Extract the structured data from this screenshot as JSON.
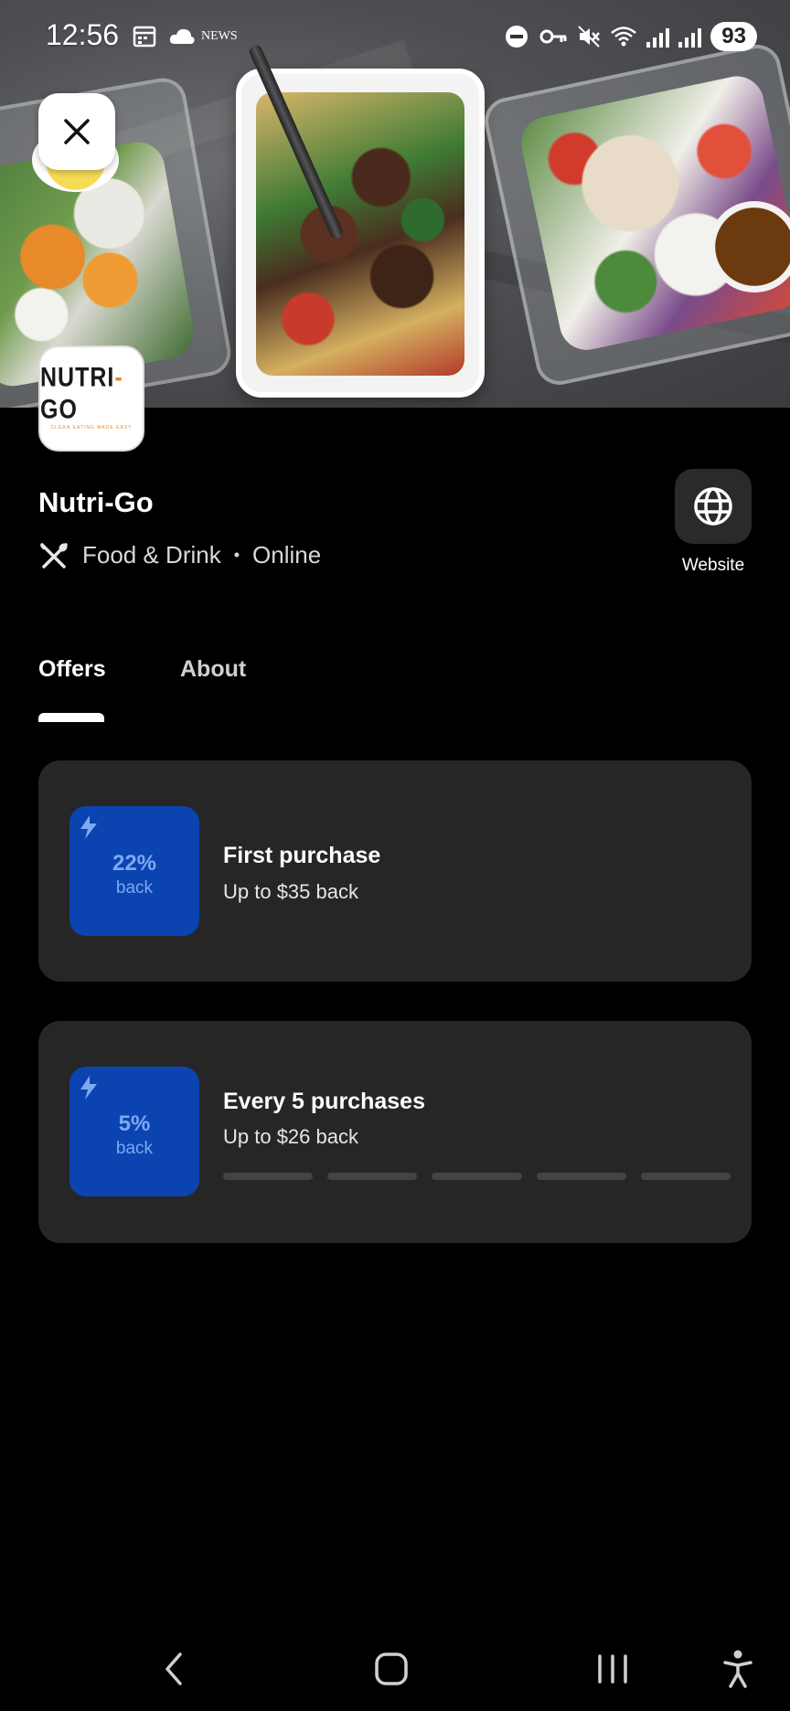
{
  "status_bar": {
    "time": "12:56",
    "news_label": "NEWS",
    "battery": "93"
  },
  "merchant": {
    "name": "Nutri-Go",
    "category": "Food & Drink",
    "separator": "•",
    "channel": "Online",
    "logo_text_left": "NUTRI",
    "logo_text_dot": "-",
    "logo_text_right": "GO",
    "logo_tagline": "CLEAN EATING MADE EASY"
  },
  "actions": {
    "website_label": "Website"
  },
  "tabs": [
    {
      "label": "Offers",
      "active": true
    },
    {
      "label": "About",
      "active": false
    }
  ],
  "offers": [
    {
      "percent": "22%",
      "back_label": "back",
      "title": "First purchase",
      "subtitle": "Up to $35 back"
    },
    {
      "percent": "5%",
      "back_label": "back",
      "title": "Every 5 purchases",
      "subtitle": "Up to $26 back",
      "progress_completed": 0,
      "progress_total": 5
    }
  ],
  "colors": {
    "badge_bg": "#0b43b1",
    "badge_text": "#7fa8f0",
    "card_bg": "#262626",
    "page_bg": "#000000"
  },
  "icons": {
    "close": "close-icon",
    "website": "globe-icon",
    "category": "utensils-icon",
    "offer": "lightning-bolt-icon",
    "nav": [
      "back-icon",
      "home-icon",
      "recents-icon",
      "accessibility-icon"
    ]
  }
}
